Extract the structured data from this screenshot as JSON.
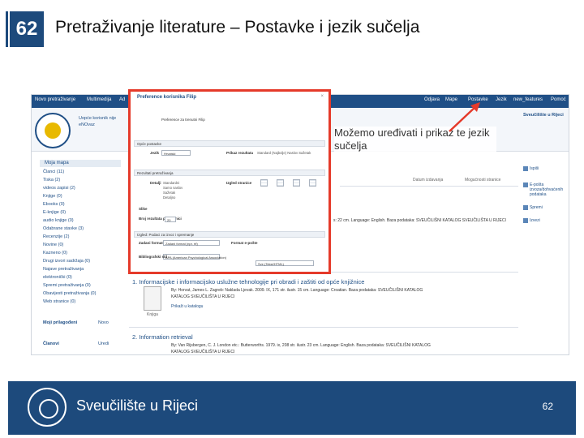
{
  "slide": {
    "number": "62",
    "title": "Pretraživanje literature – Postavke i jezik sučelja",
    "annotation": "Možemo uređivati i prikaz te jezik sučelja",
    "footer_name": "Sveučilište u Rijeci",
    "footer_page": "62"
  },
  "screenshot": {
    "topbar": {
      "new_search": "Novo pretraživanje",
      "multimedia": "Multimedija",
      "more": "Ad",
      "logout": "Odjava",
      "folder": "Mape",
      "settings": "Postavke",
      "language": "Jezik",
      "new_features": "new_features",
      "help": "Pomoć"
    },
    "brand": {
      "user_line1": "Uopće korisnik nije",
      "user_line2": "eNOvaz",
      "institution": "Sveučilište u Rijeci"
    },
    "sidebar": {
      "heading": "Moja mapa",
      "items": [
        "Članci (11)",
        "Tiska (2)",
        "videos zapisi (2)",
        "Knjige (0)",
        "Ebooks (0)",
        "E-knjige (0)",
        "audio knjige (0)",
        "Odabrane stavke (3)",
        "Recenzije (2)",
        "Novine (0)",
        "Kazneno (0)",
        "Drugi izvori sadržaja (0)",
        "Najave pretraživanja",
        "elektronički (0)",
        "Spremi pretraživanja (0)",
        "Obavijesti pretraživanja (0)",
        "Web stranice (0)"
      ],
      "my_folder": "Moji prilagođeni",
      "new": "Novo",
      "members": "Članovi",
      "edit": "Uredi"
    },
    "results": [
      {
        "title": "1. Informacijske i informacijsko uslužne tehnologije pri obradi i zaštiti od opće knjižnice",
        "meta1": "By: Horvat, James L. Zagreb: Naklada Ljevak. 2009. IX, 171 str. ilustr. 15 cm. Language: Croatian. Baza podataka: SVEUČILIŠNI KATALOG",
        "meta2": "KATALOG SVEUČILIŠTA U RIJECI",
        "link": "Prikaži u katalogu",
        "thumb": "Knjiga"
      },
      {
        "title": "2. Information retrieval",
        "meta1": "By: Van Rijsbergen, C. J. London etc.: Butterworths. 1979. ix, 208 str. ilustr. 23 cm. Language: English. Baza podataka: SVEUČILIŠNI KATALOG",
        "meta2": "KATALOG SVEUČILIŠTA U RIJECI"
      }
    ],
    "result_snippet": "s: 22 cm. Language: English. Baza podataka: SVEUČILIŠNI KATALOG SVEUČILIŠTA U RIJECI",
    "sort_label": "Datum izdavanja",
    "options_label": "Mogućnosti stranice",
    "right_panel": [
      "Ispiši",
      "E-pošta izvoza/dohvaćenih podataka",
      "Spremi",
      "Izvezi"
    ],
    "dialog": {
      "title": "Preference korisnika Filip",
      "close": "×",
      "subtitle": "Preference za trenutni Filip",
      "sec_general": "Opće postavke",
      "lang_label": "Jezik",
      "lang_value": "Hrvatski",
      "pattern_label": "Prikaz rezultata",
      "pattern_opts": "Standard (Najbolje) Naslov Sažetak",
      "sec_results": "Rezultati pretraživanja",
      "display_label": "Detalji",
      "display_opts": [
        "Standardni",
        "Samo naslov",
        "Sažetak",
        "Detaljno"
      ],
      "layout_label": "Izgled stranice",
      "images_label": "Slike",
      "per_page_label": "Broj rezultata po stranici",
      "per_page_value": "20",
      "sec_export": "Izgled: Podaci za izvoz i spremanje",
      "format_label": "Zadani format",
      "format_value": "Zadani format (npr. rtf)",
      "bib_label": "Bibliografski stil",
      "bib_value": "APA (American Psychological Association)",
      "email_label": "Format e-pošte",
      "email_value": "Sve (Tekst/HTML)"
    }
  },
  "colors": {
    "brand_blue": "#1d4a7c",
    "highlight": "#e53a2a"
  }
}
